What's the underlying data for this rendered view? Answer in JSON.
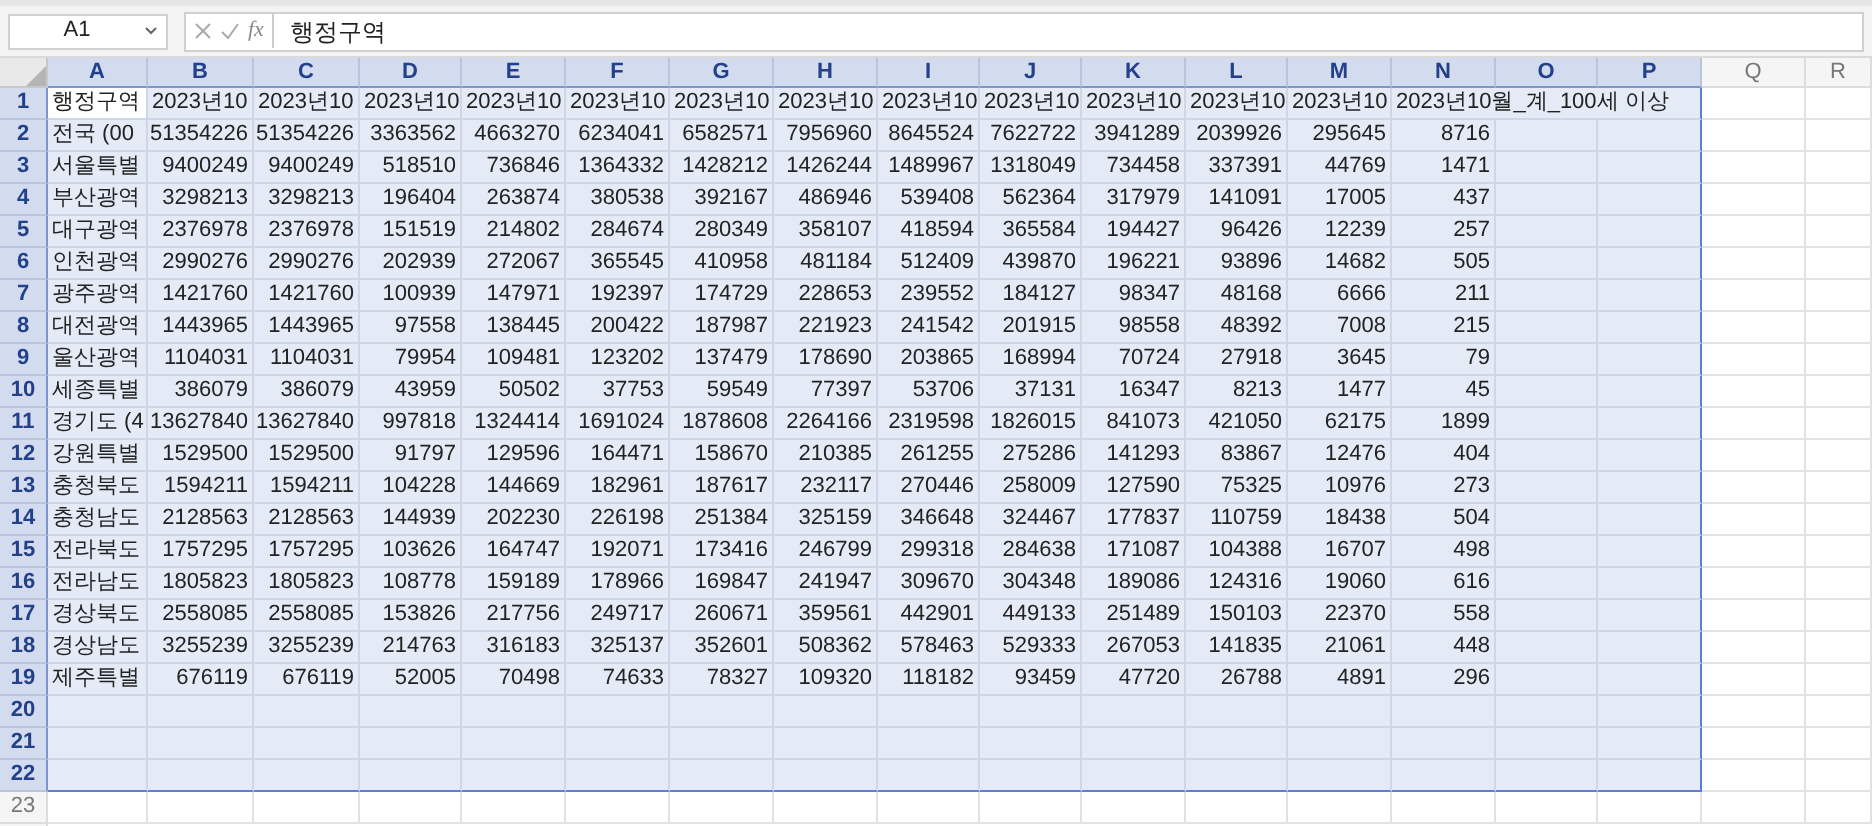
{
  "name_box": "A1",
  "formula_bar": {
    "function_label": "fx",
    "value": "행정구역"
  },
  "columns": [
    {
      "label": "A",
      "selected": true
    },
    {
      "label": "B",
      "selected": true
    },
    {
      "label": "C",
      "selected": true
    },
    {
      "label": "D",
      "selected": true
    },
    {
      "label": "E",
      "selected": true
    },
    {
      "label": "F",
      "selected": true
    },
    {
      "label": "G",
      "selected": true
    },
    {
      "label": "H",
      "selected": true
    },
    {
      "label": "I",
      "selected": true
    },
    {
      "label": "J",
      "selected": true
    },
    {
      "label": "K",
      "selected": true
    },
    {
      "label": "L",
      "selected": true
    },
    {
      "label": "M",
      "selected": true
    },
    {
      "label": "N",
      "selected": true
    },
    {
      "label": "O",
      "selected": true
    },
    {
      "label": "P",
      "selected": true
    },
    {
      "label": "Q",
      "selected": false
    },
    {
      "label": "R",
      "selected": false
    }
  ],
  "rows": [
    {
      "number": "1",
      "selected": true,
      "active": true,
      "kind": "header",
      "cells": [
        "행정구역",
        "2023년10",
        "2023년10",
        "2023년10",
        "2023년10",
        "2023년10",
        "2023년10",
        "2023년10",
        "2023년10",
        "2023년10",
        "2023년10",
        "2023년10",
        "2023년10",
        "2023년10월_계_100세 이상"
      ]
    },
    {
      "number": "2",
      "selected": true,
      "active": false,
      "kind": "data",
      "cells": [
        "전국 (00",
        "51354226",
        "51354226",
        "3363562",
        "4663270",
        "6234041",
        "6582571",
        "7956960",
        "8645524",
        "7622722",
        "3941289",
        "2039926",
        "295645",
        "8716"
      ]
    },
    {
      "number": "3",
      "selected": true,
      "active": false,
      "kind": "data",
      "cells": [
        "서울특별",
        "9400249",
        "9400249",
        "518510",
        "736846",
        "1364332",
        "1428212",
        "1426244",
        "1489967",
        "1318049",
        "734458",
        "337391",
        "44769",
        "1471"
      ]
    },
    {
      "number": "4",
      "selected": true,
      "active": false,
      "kind": "data",
      "cells": [
        "부산광역",
        "3298213",
        "3298213",
        "196404",
        "263874",
        "380538",
        "392167",
        "486946",
        "539408",
        "562364",
        "317979",
        "141091",
        "17005",
        "437"
      ]
    },
    {
      "number": "5",
      "selected": true,
      "active": false,
      "kind": "data",
      "cells": [
        "대구광역",
        "2376978",
        "2376978",
        "151519",
        "214802",
        "284674",
        "280349",
        "358107",
        "418594",
        "365584",
        "194427",
        "96426",
        "12239",
        "257"
      ]
    },
    {
      "number": "6",
      "selected": true,
      "active": false,
      "kind": "data",
      "cells": [
        "인천광역",
        "2990276",
        "2990276",
        "202939",
        "272067",
        "365545",
        "410958",
        "481184",
        "512409",
        "439870",
        "196221",
        "93896",
        "14682",
        "505"
      ]
    },
    {
      "number": "7",
      "selected": true,
      "active": false,
      "kind": "data",
      "cells": [
        "광주광역",
        "1421760",
        "1421760",
        "100939",
        "147971",
        "192397",
        "174729",
        "228653",
        "239552",
        "184127",
        "98347",
        "48168",
        "6666",
        "211"
      ]
    },
    {
      "number": "8",
      "selected": true,
      "active": false,
      "kind": "data",
      "cells": [
        "대전광역",
        "1443965",
        "1443965",
        "97558",
        "138445",
        "200422",
        "187987",
        "221923",
        "241542",
        "201915",
        "98558",
        "48392",
        "7008",
        "215"
      ]
    },
    {
      "number": "9",
      "selected": true,
      "active": false,
      "kind": "data",
      "cells": [
        "울산광역",
        "1104031",
        "1104031",
        "79954",
        "109481",
        "123202",
        "137479",
        "178690",
        "203865",
        "168994",
        "70724",
        "27918",
        "3645",
        "79"
      ]
    },
    {
      "number": "10",
      "selected": true,
      "active": false,
      "kind": "data",
      "cells": [
        "세종특별",
        "386079",
        "386079",
        "43959",
        "50502",
        "37753",
        "59549",
        "77397",
        "53706",
        "37131",
        "16347",
        "8213",
        "1477",
        "45"
      ]
    },
    {
      "number": "11",
      "selected": true,
      "active": false,
      "kind": "data",
      "cells": [
        "경기도 (4",
        "13627840",
        "13627840",
        "997818",
        "1324414",
        "1691024",
        "1878608",
        "2264166",
        "2319598",
        "1826015",
        "841073",
        "421050",
        "62175",
        "1899"
      ]
    },
    {
      "number": "12",
      "selected": true,
      "active": false,
      "kind": "data",
      "cells": [
        "강원특별",
        "1529500",
        "1529500",
        "91797",
        "129596",
        "164471",
        "158670",
        "210385",
        "261255",
        "275286",
        "141293",
        "83867",
        "12476",
        "404"
      ]
    },
    {
      "number": "13",
      "selected": true,
      "active": false,
      "kind": "data",
      "cells": [
        "충청북도",
        "1594211",
        "1594211",
        "104228",
        "144669",
        "182961",
        "187617",
        "232117",
        "270446",
        "258009",
        "127590",
        "75325",
        "10976",
        "273"
      ]
    },
    {
      "number": "14",
      "selected": true,
      "active": false,
      "kind": "data",
      "cells": [
        "충청남도",
        "2128563",
        "2128563",
        "144939",
        "202230",
        "226198",
        "251384",
        "325159",
        "346648",
        "324467",
        "177837",
        "110759",
        "18438",
        "504"
      ]
    },
    {
      "number": "15",
      "selected": true,
      "active": false,
      "kind": "data",
      "cells": [
        "전라북도",
        "1757295",
        "1757295",
        "103626",
        "164747",
        "192071",
        "173416",
        "246799",
        "299318",
        "284638",
        "171087",
        "104388",
        "16707",
        "498"
      ]
    },
    {
      "number": "16",
      "selected": true,
      "active": false,
      "kind": "data",
      "cells": [
        "전라남도",
        "1805823",
        "1805823",
        "108778",
        "159189",
        "178966",
        "169847",
        "241947",
        "309670",
        "304348",
        "189086",
        "124316",
        "19060",
        "616"
      ]
    },
    {
      "number": "17",
      "selected": true,
      "active": false,
      "kind": "data",
      "cells": [
        "경상북도",
        "2558085",
        "2558085",
        "153826",
        "217756",
        "249717",
        "260671",
        "359561",
        "442901",
        "449133",
        "251489",
        "150103",
        "22370",
        "558"
      ]
    },
    {
      "number": "18",
      "selected": true,
      "active": false,
      "kind": "data",
      "cells": [
        "경상남도",
        "3255239",
        "3255239",
        "214763",
        "316183",
        "325137",
        "352601",
        "508362",
        "578463",
        "529333",
        "267053",
        "141835",
        "21061",
        "448"
      ]
    },
    {
      "number": "19",
      "selected": true,
      "active": false,
      "kind": "data",
      "cells": [
        "제주특별",
        "676119",
        "676119",
        "52005",
        "70498",
        "74633",
        "78327",
        "109320",
        "118182",
        "93459",
        "47720",
        "26788",
        "4891",
        "296"
      ]
    },
    {
      "number": "20",
      "selected": true,
      "active": false,
      "kind": "data"
    },
    {
      "number": "21",
      "selected": true,
      "active": false,
      "kind": "data"
    },
    {
      "number": "22",
      "selected": true,
      "active": false,
      "kind": "data"
    },
    {
      "number": "23",
      "selected": false,
      "active": false,
      "kind": "data"
    }
  ]
}
